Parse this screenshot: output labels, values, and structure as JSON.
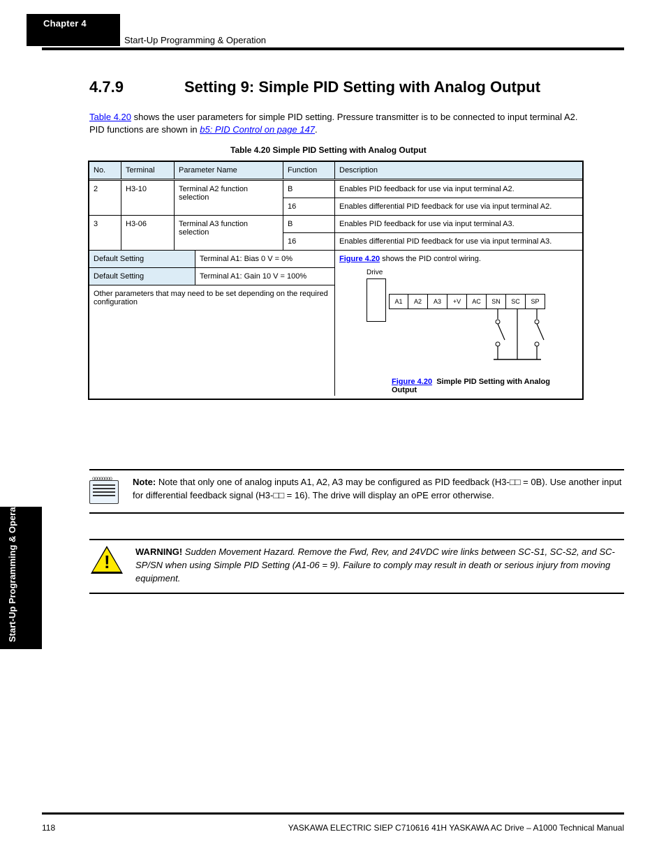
{
  "chapter": {
    "label": "Chapter 4",
    "title": "Start-Up Programming & Operation"
  },
  "section": {
    "number": "4.7.9",
    "title": "Setting 9: Simple PID Setting with Analog Output"
  },
  "intro": {
    "line1": "Table 4.20",
    "line1_rest": " shows the user parameters for simple PID setting. Pressure transmitter is to be connected to input terminal A2.",
    "line2_pre": "PID functions are shown in ",
    "line2_link": "b5: PID Control on page 147",
    "line2_post": "."
  },
  "table_caption": "Table 4.20 Simple PID Setting with Analog Output",
  "headers": {
    "no": "No.",
    "terminal": "Terminal",
    "name": "Parameter Name",
    "func": "Function",
    "desc": "Description"
  },
  "rows": [
    {
      "no": "2",
      "terminal": "H3-10",
      "name": "Terminal A2 function selection",
      "func_a": "B",
      "desc_a": "Enables PID feedback for use via input terminal A2.",
      "func_b": "16",
      "desc_b": "Enables differential PID feedback for use via input terminal A2."
    },
    {
      "no": "3",
      "terminal": "H3-06",
      "name": "Terminal A3 function selection",
      "func_a": "B",
      "desc_a": "Enables PID feedback for use via input terminal A3.",
      "func_b": "16",
      "desc_b": "Enables differential PID feedback for use via input terminal A3."
    }
  ],
  "default_setting": {
    "label": "Default Setting",
    "value": "Terminal A1: Bias 0 V = 0%"
  },
  "default_setting2": {
    "label": "Default Setting",
    "value": "Terminal A1: Gain 10 V = 100%"
  },
  "wiring_comment": "Other parameters that may need to be set depending on the required configuration",
  "ref_fig_title": "Figure 4.20",
  "ref_fig_rest": " shows the PID control wiring.",
  "terminals": [
    "A1",
    "A2",
    "A3",
    "+V",
    "AC",
    "SN",
    "SC",
    "SP"
  ],
  "drive_label": "Drive",
  "fig_caption": "Figure 4.20",
  "fig_cap_rest": " Simple PID Setting with Analog Output",
  "note": {
    "label": "Note:",
    "body": "Note that only one of analog inputs A1, A2, A3 may be configured as PID feedback (H3-□□ = 0B). Use another input for differential feedback signal (H3-□□ = 16). The drive will display an oPE error otherwise."
  },
  "warning": {
    "label": "WARNING!",
    "body": " Sudden Movement Hazard. Remove the Fwd, Rev, and 24VDC wire links between SC-S1, SC-S2, and SC-SP/SN when using Simple PID Setting (A1-06 = 9). Failure to comply may result in death or serious injury from moving equipment."
  },
  "footer": {
    "page": "118",
    "doc": "YASKAWA ELECTRIC SIEP C710616 41H YASKAWA AC Drive – A1000 Technical Manual"
  }
}
